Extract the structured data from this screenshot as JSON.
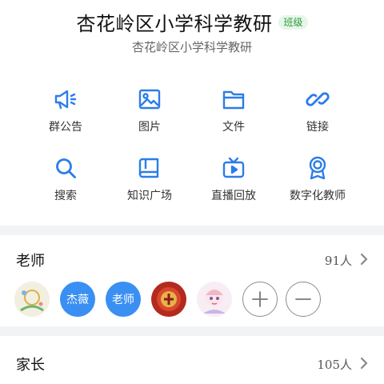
{
  "header": {
    "title": "杏花岭区小学科学教研",
    "badge": "班级",
    "subtitle": "杏花岭区小学科学教研"
  },
  "features": [
    {
      "label": "群公告",
      "icon": "megaphone-icon"
    },
    {
      "label": "图片",
      "icon": "image-icon"
    },
    {
      "label": "文件",
      "icon": "folder-icon"
    },
    {
      "label": "链接",
      "icon": "link-icon"
    },
    {
      "label": "搜索",
      "icon": "search-icon"
    },
    {
      "label": "知识广场",
      "icon": "book-icon"
    },
    {
      "label": "直播回放",
      "icon": "tv-play-icon"
    },
    {
      "label": "数字化教师",
      "icon": "medal-icon"
    }
  ],
  "teachers": {
    "title": "老师",
    "count": "91人",
    "members": [
      {
        "type": "image",
        "name": "avatar-image-1"
      },
      {
        "type": "text",
        "text": "杰薇"
      },
      {
        "type": "text",
        "text": "老师"
      },
      {
        "type": "image",
        "name": "avatar-image-2"
      },
      {
        "type": "image",
        "name": "avatar-image-3"
      }
    ],
    "actions": [
      "plus-icon",
      "minus-icon"
    ]
  },
  "parents": {
    "title": "家长",
    "count": "105人"
  },
  "colors": {
    "accent": "#2b7de9",
    "avatar_bg": "#3a8ff3",
    "badge_text": "#2e9a3f",
    "badge_bg": "#e6f6e8",
    "separator": "#f2f3f5"
  }
}
